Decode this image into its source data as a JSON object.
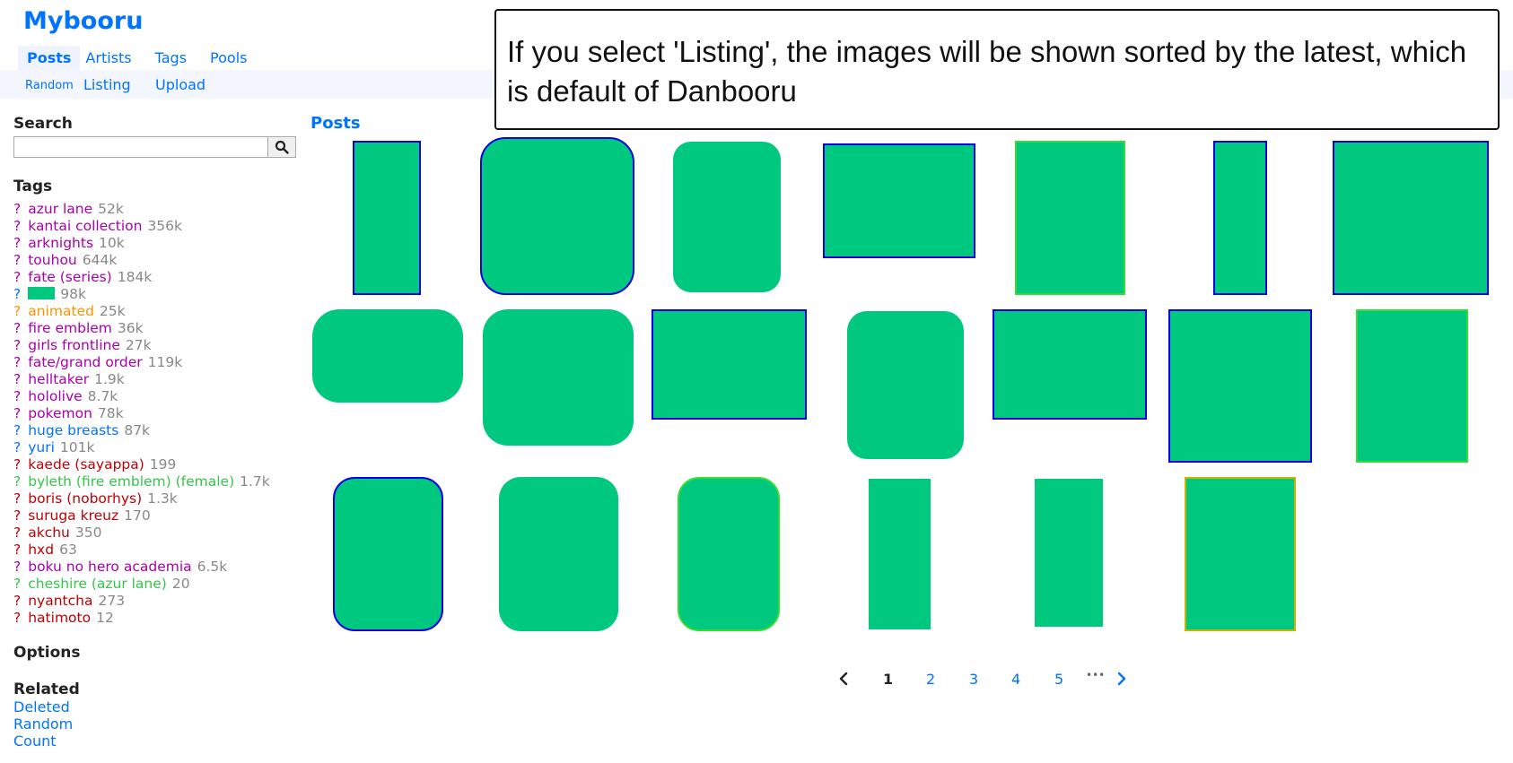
{
  "header": {
    "logo": "Mybooru",
    "nav": [
      "Posts",
      "Artists",
      "Tags",
      "Pools"
    ],
    "subnav": {
      "random": "Random",
      "listing": "Listing",
      "upload": "Upload"
    }
  },
  "callout": {
    "text": "If you select 'Listing', the images will be shown sorted by the latest, which is default of Danbooru"
  },
  "sidebar": {
    "search_heading": "Search",
    "search_value": "",
    "tags_heading": "Tags",
    "tags": [
      {
        "q": "?",
        "name": "azur lane",
        "count": "52k",
        "color": "#a800aa"
      },
      {
        "q": "?",
        "name": "kantai collection",
        "count": "356k",
        "color": "#a800aa"
      },
      {
        "q": "?",
        "name": "arknights",
        "count": "10k",
        "color": "#a800aa"
      },
      {
        "q": "?",
        "name": "touhou",
        "count": "644k",
        "color": "#a800aa"
      },
      {
        "q": "?",
        "name": "fate (series)",
        "count": "184k",
        "color": "#a800aa"
      },
      {
        "q": "?",
        "name": "",
        "count": "98k",
        "color": "#0073ff",
        "redacted": true
      },
      {
        "q": "?",
        "name": "animated",
        "count": "25k",
        "color": "#fd9200"
      },
      {
        "q": "?",
        "name": "fire emblem",
        "count": "36k",
        "color": "#a800aa"
      },
      {
        "q": "?",
        "name": "girls frontline",
        "count": "27k",
        "color": "#a800aa"
      },
      {
        "q": "?",
        "name": "fate/grand order",
        "count": "119k",
        "color": "#a800aa"
      },
      {
        "q": "?",
        "name": "helltaker",
        "count": "1.9k",
        "color": "#a800aa"
      },
      {
        "q": "?",
        "name": "hololive",
        "count": "8.7k",
        "color": "#a800aa"
      },
      {
        "q": "?",
        "name": "pokemon",
        "count": "78k",
        "color": "#a800aa"
      },
      {
        "q": "?",
        "name": "huge breasts",
        "count": "87k",
        "color": "#0073ff"
      },
      {
        "q": "?",
        "name": "yuri",
        "count": "101k",
        "color": "#0073ff"
      },
      {
        "q": "?",
        "name": "kaede (sayappa)",
        "count": "199",
        "color": "#c00004"
      },
      {
        "q": "?",
        "name": "byleth (fire emblem) (female)",
        "count": "1.7k",
        "color": "#35c64a"
      },
      {
        "q": "?",
        "name": "boris (noborhys)",
        "count": "1.3k",
        "color": "#c00004"
      },
      {
        "q": "?",
        "name": "suruga kreuz",
        "count": "170",
        "color": "#c00004"
      },
      {
        "q": "?",
        "name": "akchu",
        "count": "350",
        "color": "#c00004"
      },
      {
        "q": "?",
        "name": "hxd",
        "count": "63",
        "color": "#c00004"
      },
      {
        "q": "?",
        "name": "boku no hero academia",
        "count": "6.5k",
        "color": "#a800aa"
      },
      {
        "q": "?",
        "name": "cheshire (azur lane)",
        "count": "20",
        "color": "#35c64a"
      },
      {
        "q": "?",
        "name": "nyantcha",
        "count": "273",
        "color": "#c00004"
      },
      {
        "q": "?",
        "name": "hatimoto",
        "count": "12",
        "color": "#c00004"
      }
    ],
    "options_heading": "Options",
    "related_heading": "Related",
    "related_links": [
      "Deleted",
      "Random",
      "Count"
    ]
  },
  "posts": {
    "heading": "Posts"
  },
  "pagination": {
    "pages": [
      "1",
      "2",
      "3",
      "4",
      "5"
    ],
    "current": "1",
    "ellipsis": "•••"
  },
  "colors": {
    "link": "#0073ff",
    "redaction": "#00c97f"
  }
}
